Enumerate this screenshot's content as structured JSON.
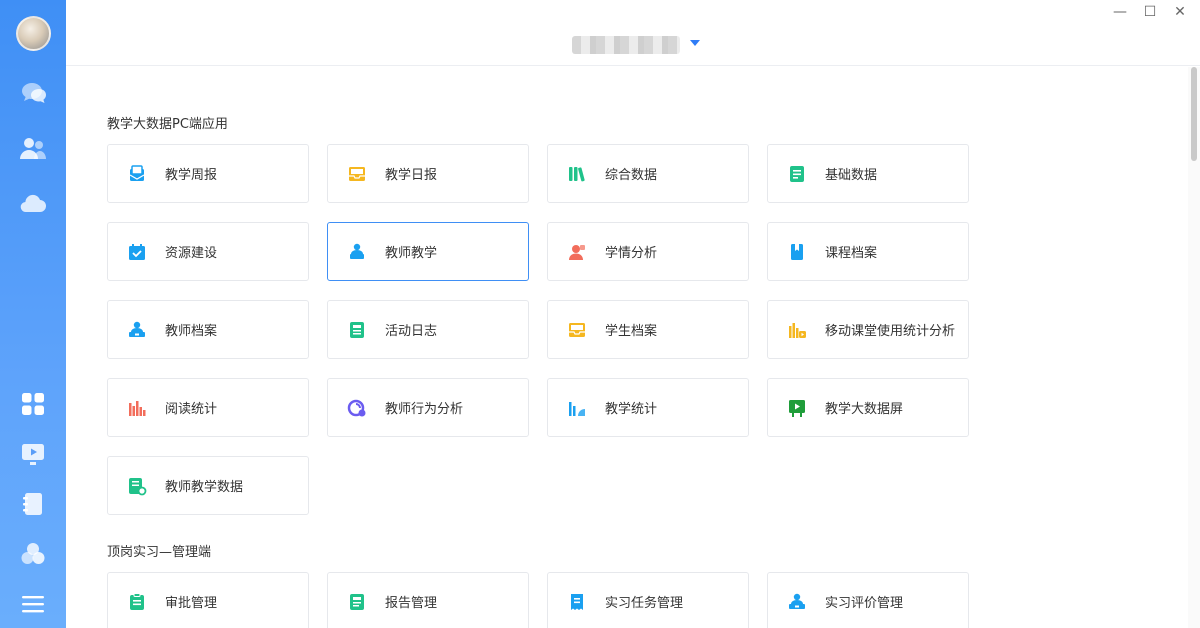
{
  "sidebar": {
    "items": [
      {
        "name": "chat-icon",
        "color": "#ffffff"
      },
      {
        "name": "contacts-icon",
        "color": "#ffffff"
      },
      {
        "name": "cloud-icon",
        "color": "#ffffff"
      },
      {
        "name": "apps-grid-icon",
        "color": "#ffffff"
      },
      {
        "name": "video-screen-icon",
        "color": "#ffffff"
      },
      {
        "name": "notebook-icon",
        "color": "#ffffff"
      },
      {
        "name": "circles-icon",
        "color": "#ffffff"
      },
      {
        "name": "menu-icon",
        "color": "#ffffff"
      }
    ]
  },
  "header": {
    "org_name": "",
    "accent": "#2f7cf6"
  },
  "sections": [
    {
      "title": "教学大数据PC端应用",
      "cards": [
        {
          "label": "教学周报",
          "icon": "envelope-icon",
          "color": "#1aa0f0"
        },
        {
          "label": "教学日报",
          "icon": "inbox-icon",
          "color": "#f5b720"
        },
        {
          "label": "综合数据",
          "icon": "books-icon",
          "color": "#20c28a"
        },
        {
          "label": "基础数据",
          "icon": "document-icon",
          "color": "#20c28a"
        },
        {
          "label": "资源建设",
          "icon": "calendar-check-icon",
          "color": "#1aa0f0"
        },
        {
          "label": "教师教学",
          "icon": "teacher-icon",
          "color": "#1aa0f0",
          "active": true
        },
        {
          "label": "学情分析",
          "icon": "student-analysis-icon",
          "color": "#f26d5b"
        },
        {
          "label": "课程档案",
          "icon": "bookmark-book-icon",
          "color": "#1aa0f0"
        },
        {
          "label": "教师档案",
          "icon": "person-desk-icon",
          "color": "#1aa0f0"
        },
        {
          "label": "活动日志",
          "icon": "log-icon",
          "color": "#20c28a"
        },
        {
          "label": "学生档案",
          "icon": "inbox-icon",
          "color": "#f5b720"
        },
        {
          "label": "移动课堂使用统计分析",
          "icon": "bar-video-icon",
          "color": "#f5b720"
        },
        {
          "label": "阅读统计",
          "icon": "bar-chart-icon",
          "color": "#f26d5b"
        },
        {
          "label": "教师行为分析",
          "icon": "behavior-icon",
          "color": "#6b5cf0"
        },
        {
          "label": "教学统计",
          "icon": "stats-icon",
          "color": "#1aa0f0"
        },
        {
          "label": "教学大数据屏",
          "icon": "screen-play-icon",
          "color": "#1f9d3a"
        },
        {
          "label": "教师教学数据",
          "icon": "data-search-icon",
          "color": "#20c28a"
        }
      ]
    },
    {
      "title": "顶岗实习—管理端",
      "cards": [
        {
          "label": "审批管理",
          "icon": "clipboard-icon",
          "color": "#20c28a"
        },
        {
          "label": "报告管理",
          "icon": "report-icon",
          "color": "#20c28a"
        },
        {
          "label": "实习任务管理",
          "icon": "receipt-icon",
          "color": "#1aa0f0"
        },
        {
          "label": "实习评价管理",
          "icon": "person-desk-icon",
          "color": "#1aa0f0"
        }
      ]
    }
  ],
  "window": {
    "minimize": "—",
    "maximize": "☐",
    "close": "✕"
  }
}
